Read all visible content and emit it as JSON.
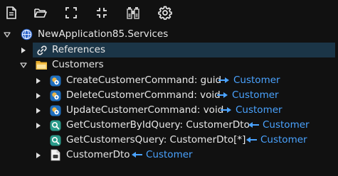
{
  "toolbar": {
    "buttons": [
      {
        "name": "new-file-icon"
      },
      {
        "name": "open-folder-icon"
      },
      {
        "name": "expand-all-icon"
      },
      {
        "name": "collapse-all-icon"
      },
      {
        "name": "find-binoculars-icon"
      },
      {
        "name": "settings-gear-icon"
      }
    ]
  },
  "tree": {
    "root": {
      "label": "NewApplication85.Services",
      "icon": "globe-services-icon",
      "expanded": true
    },
    "references": {
      "label": "References",
      "icon": "link-icon",
      "selected": true
    },
    "customers": {
      "label": "Customers",
      "icon": "folder-icon",
      "expanded": true
    },
    "items": [
      {
        "label": "CreateCustomerCommand: guid",
        "target": "Customer",
        "icon": "command-icon"
      },
      {
        "label": "DeleteCustomerCommand: void",
        "target": "Customer",
        "icon": "command-icon"
      },
      {
        "label": "UpdateCustomerCommand: void",
        "target": "Customer",
        "icon": "command-icon"
      },
      {
        "label": "GetCustomerByIdQuery: CustomerDto",
        "target": "Customer",
        "icon": "query-icon"
      },
      {
        "label": "GetCustomersQuery: CustomerDto[*]",
        "target": "Customer",
        "icon": "query-icon"
      },
      {
        "label": "CustomerDto",
        "target": "Customer",
        "icon": "dto-file-icon"
      }
    ]
  },
  "colors": {
    "background": "#111111",
    "text": "#e8e8e8",
    "link": "#4aa3ff",
    "selection": "#1b3547",
    "command_icon": "#1f6fbf",
    "query_icon": "#2a9b8a"
  }
}
